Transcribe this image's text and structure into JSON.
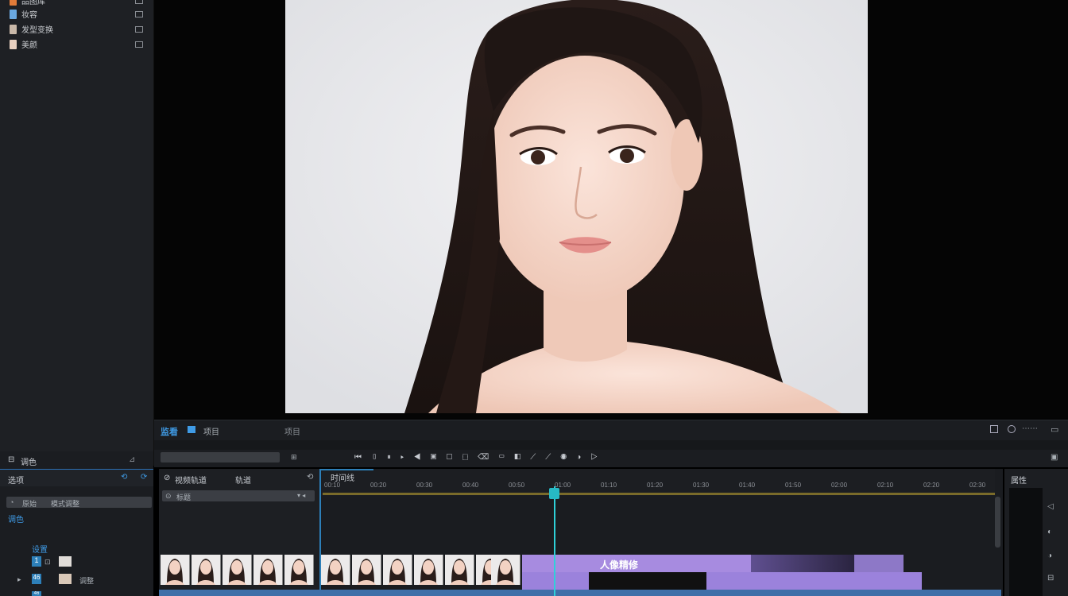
{
  "project_panel": {
    "items": [
      {
        "label": "品图库",
        "color": "#e07b39"
      },
      {
        "label": "妆容",
        "color": "#6aa8e0"
      },
      {
        "label": "发型变换",
        "color": "#c9b8a8"
      },
      {
        "label": "美颜",
        "color": "#e8d0c0"
      }
    ]
  },
  "tabbar": {
    "tab_active": "监看",
    "tab2": "项目",
    "tab3": "项目",
    "right_icons": [
      "layout-icon",
      "settings-icon",
      "more-icon"
    ]
  },
  "left_bottom": {
    "header": "调色",
    "row1": "选项",
    "row2_a": "原始",
    "row2_b": "模式调整",
    "section1": "调色",
    "section2": "设置",
    "v_row1": "1",
    "v_row2": "46",
    "v_row3": "46",
    "v_row3_label": "调整"
  },
  "track_headers": {
    "title": "视频轨道",
    "subtitle": "轨道",
    "row_label": "标题"
  },
  "timeline": {
    "ruler_title": "时间线",
    "ticks": [
      "00:10",
      "00:20",
      "00:30",
      "00:40",
      "00:50",
      "01:00",
      "01:10",
      "01:20",
      "01:30",
      "01:40",
      "01:50",
      "02:00",
      "02:10",
      "02:20",
      "02:30"
    ],
    "clip_title": "人像精修",
    "accent": "#a78be0",
    "playhead_color": "#2fd0d8"
  },
  "right_panel": {
    "label": "属性"
  }
}
